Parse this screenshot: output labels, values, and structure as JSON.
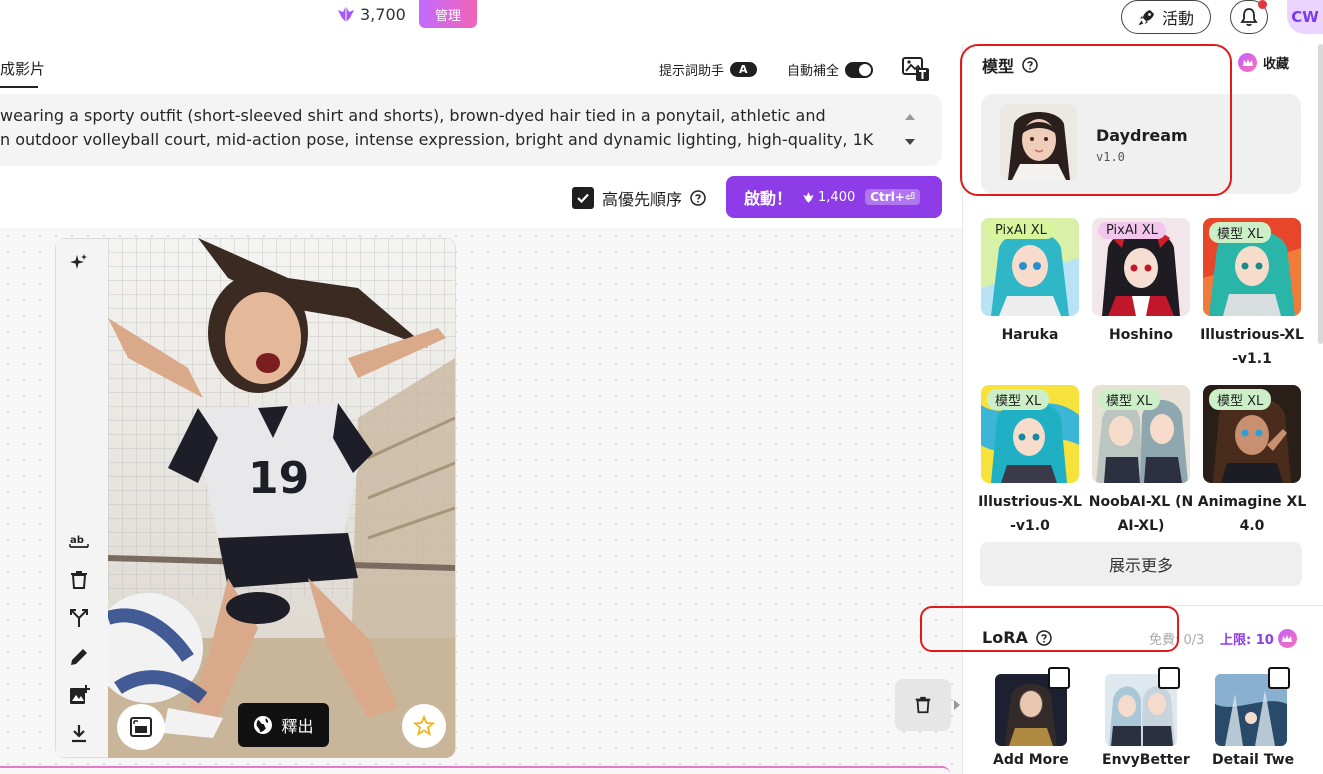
{
  "header": {
    "credits": "3,700",
    "manage_label": "管理",
    "event_label": "活動",
    "avatar_initials": "CW"
  },
  "composer": {
    "tab_label": "成影片",
    "prompt_helper_label": "提示詞助手",
    "prompt_helper_key": "A",
    "autocomplete_label": "自動補全",
    "prompt_line1": "wearing a sporty outfit (short-sleeved shirt and shorts), brown-dyed hair tied in a ponytail, athletic and",
    "prompt_line2": "n outdoor volleyball court, mid-action pose, intense expression, bright and dynamic lighting, high-quality, 1K",
    "priority_label": "高優先順序",
    "launch_label": "啟動！",
    "launch_cost": "1,400",
    "launch_shortcut": "Ctrl+⏎"
  },
  "canvas": {
    "publish_label": "釋出"
  },
  "model": {
    "title": "模型",
    "collect_label": "收藏",
    "selected_name": "Daydream",
    "selected_version": "v1.0",
    "items": [
      {
        "badge": "PixAI XL",
        "name": "Haruka"
      },
      {
        "badge": "PixAI XL",
        "name": "Hoshino"
      },
      {
        "badge": "模型 XL",
        "name": "Illustrious-XL\n-v1.1"
      },
      {
        "badge": "模型 XL",
        "name": "Illustrious-XL\n-v1.0"
      },
      {
        "badge": "模型 XL",
        "name": "NoobAI-XL (N\nAI-XL)"
      },
      {
        "badge": "模型 XL",
        "name": "Animagine XL\n4.0"
      }
    ],
    "more_label": "展示更多"
  },
  "lora": {
    "title": "LoRA",
    "free_label": "免費: 0/3",
    "limit_label": "上限: 10",
    "items": [
      {
        "name": "Add More"
      },
      {
        "name": "EnvyBetter"
      },
      {
        "name": "Detail Twe"
      }
    ]
  },
  "colors": {
    "accent": "#8e3be8",
    "annotation": "#e21a1a"
  }
}
